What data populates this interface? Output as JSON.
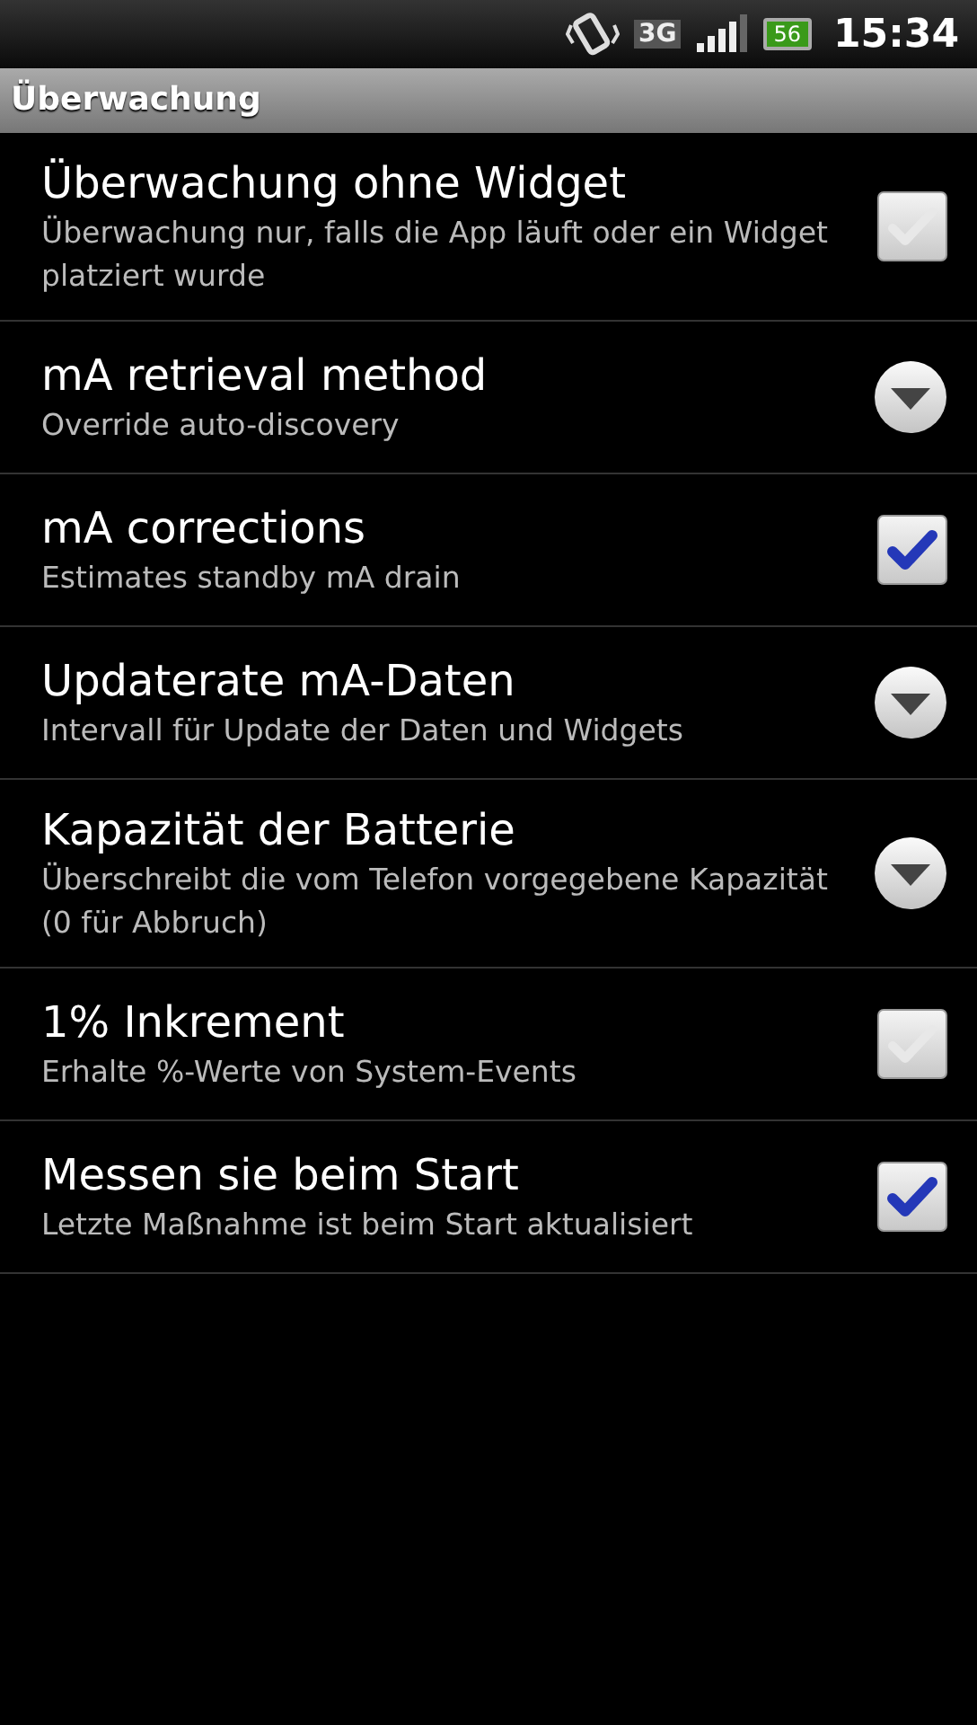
{
  "status_bar": {
    "network": "3G",
    "battery": "56",
    "time": "15:34"
  },
  "category": "Überwachung",
  "preferences": [
    {
      "kind": "checkbox",
      "title": "Überwachung ohne Widget",
      "summary": "Überwachung nur, falls die App läuft oder ein Widget platziert wurde",
      "checked": false
    },
    {
      "kind": "list",
      "title": "mA retrieval method",
      "summary": "Override auto-discovery"
    },
    {
      "kind": "checkbox",
      "title": "mA corrections",
      "summary": "Estimates standby mA drain",
      "checked": true
    },
    {
      "kind": "list",
      "title": "Updaterate mA-Daten",
      "summary": "Intervall für Update der Daten und Widgets"
    },
    {
      "kind": "list",
      "title": "Kapazität der Batterie",
      "summary": "Überschreibt die vom Telefon vorgegebene Kapazität (0 für Abbruch)"
    },
    {
      "kind": "checkbox",
      "title": "1% Inkrement",
      "summary": "Erhalte %-Werte von System-Events",
      "checked": false
    },
    {
      "kind": "checkbox",
      "title": "Messen sie beim Start",
      "summary": "Letzte Maßnahme ist beim Start aktualisiert",
      "checked": true
    }
  ]
}
